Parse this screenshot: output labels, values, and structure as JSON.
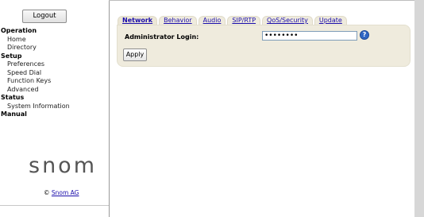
{
  "sidebar": {
    "logout_label": "Logout",
    "groups": [
      {
        "title": "Operation",
        "items": [
          "Home",
          "Directory"
        ]
      },
      {
        "title": "Setup",
        "items": [
          "Preferences",
          "Speed Dial",
          "Function Keys",
          "Advanced"
        ]
      },
      {
        "title": "Status",
        "items": [
          "System Information"
        ]
      },
      {
        "title": "Manual",
        "items": []
      }
    ],
    "logo_text": "snom",
    "copyright_prefix": "©",
    "copyright_link": "Snom AG"
  },
  "tabs": [
    {
      "label": "Network",
      "active": true
    },
    {
      "label": "Behavior",
      "active": false
    },
    {
      "label": "Audio",
      "active": false
    },
    {
      "label": "SIP/RTP",
      "active": false
    },
    {
      "label": "QoS/Security",
      "active": false
    },
    {
      "label": "Update",
      "active": false
    }
  ],
  "form": {
    "admin_login_label": "Administrator Login:",
    "admin_login_value": "••••••••",
    "help_glyph": "?",
    "apply_label": "Apply"
  },
  "colors": {
    "panel_bg": "#efebdd",
    "link": "#1a0dab",
    "help_icon": "#2f66c4"
  }
}
